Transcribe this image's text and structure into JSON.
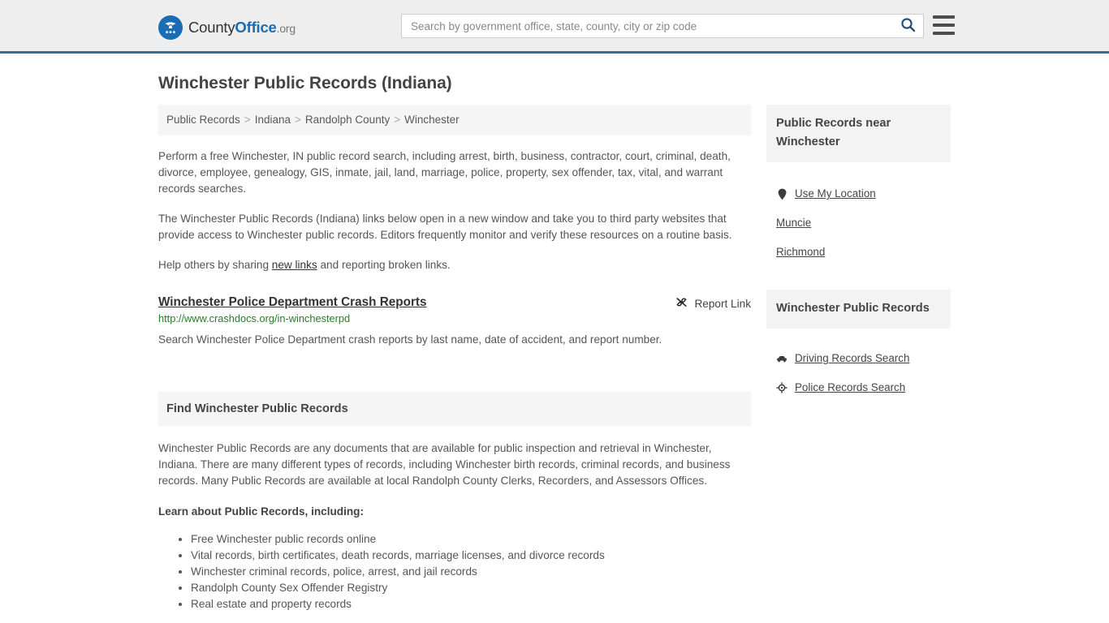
{
  "header": {
    "brand": {
      "word1": "County",
      "word2": "Office",
      "word3": ".org",
      "logo_icon": "eagle-shield-icon"
    },
    "search": {
      "placeholder": "Search by government office, state, county, city or zip code",
      "value": "",
      "search_icon": "search-icon"
    },
    "menu_icon": "hamburger-menu-icon",
    "accent_color": "#2e6da4",
    "background_color": "#eeeeee"
  },
  "page": {
    "title": "Winchester Public Records (Indiana)"
  },
  "breadcrumb": {
    "separator": ">",
    "items": [
      {
        "label": "Public Records",
        "current": false
      },
      {
        "label": "Indiana",
        "current": false
      },
      {
        "label": "Randolph County",
        "current": false
      },
      {
        "label": "Winchester",
        "current": true
      }
    ]
  },
  "intro": {
    "paragraph1": "Perform a free Winchester, IN public record search, including arrest, birth, business, contractor, court, criminal, death, divorce, employee, genealogy, GIS, inmate, jail, land, marriage, police, property, sex offender, tax, vital, and warrant records searches.",
    "paragraph2": "The Winchester Public Records (Indiana) links below open in a new window and take you to third party websites that provide access to Winchester public records. Editors frequently monitor and verify these resources on a routine basis.",
    "paragraph3_before": "Help others by sharing ",
    "paragraph3_link": "new links",
    "paragraph3_after": " and reporting broken links."
  },
  "link_entry": {
    "title": "Winchester Police Department Crash Reports",
    "report_label": "Report Link",
    "report_icon": "broken-link-icon",
    "url": "http://www.crashdocs.org/in-winchesterpd",
    "url_color": "#2a7a2a",
    "description": "Search Winchester Police Department crash reports by last name, date of accident, and report number."
  },
  "section": {
    "heading": "Find Winchester Public Records",
    "body": "Winchester Public Records are any documents that are available for public inspection and retrieval in Winchester, Indiana. There are many different types of records, including Winchester birth records, criminal records, and business records. Many Public Records are available at local Randolph County Clerks, Recorders, and Assessors Offices.",
    "subheading": "Learn about Public Records, including:",
    "bullets": [
      "Free Winchester public records online",
      "Vital records, birth certificates, death records, marriage licenses, and divorce records",
      "Winchester criminal records, police, arrest, and jail records",
      "Randolph County Sex Offender Registry",
      "Real estate and property records"
    ]
  },
  "sidebar": {
    "near_card": {
      "heading": "Public Records near Winchester",
      "items": [
        {
          "label": "Use My Location",
          "icon": "map-pin-icon"
        },
        {
          "label": "Muncie",
          "icon": ""
        },
        {
          "label": "Richmond",
          "icon": ""
        }
      ]
    },
    "records_card": {
      "heading": "Winchester Public Records",
      "items": [
        {
          "label": "Driving Records Search",
          "icon": "car-icon"
        },
        {
          "label": "Police Records Search",
          "icon": "police-badge-icon"
        }
      ]
    }
  }
}
